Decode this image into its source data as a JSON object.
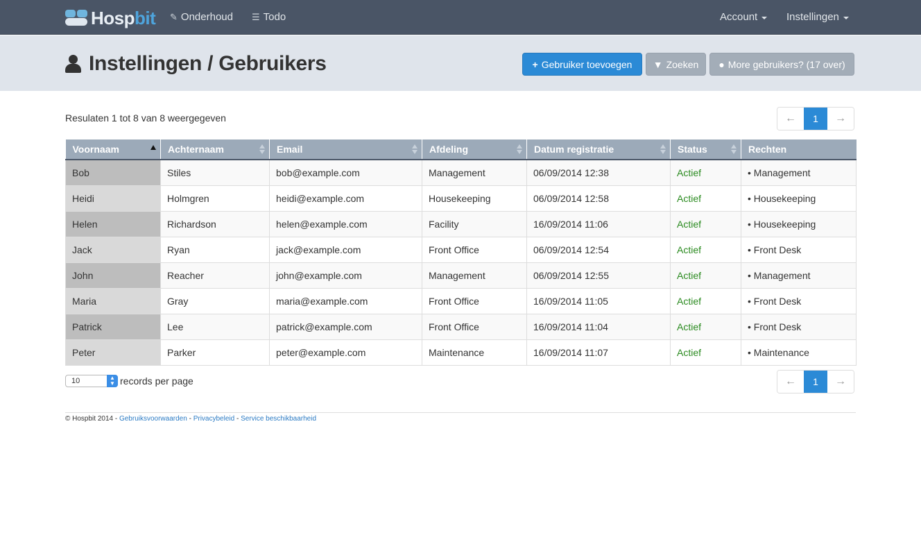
{
  "navbar": {
    "brand_main": "Hosp",
    "brand_accent": "bit",
    "maintenance_label": "Onderhoud",
    "todo_label": "Todo",
    "account_label": "Account",
    "settings_label": "Instellingen"
  },
  "header": {
    "title": "Instellingen / Gebruikers",
    "add_user_label": "Gebruiker toevoegen",
    "search_label": "Zoeken",
    "more_users_label": "More gebruikers? (17 over)"
  },
  "results": {
    "summary": "Resulaten 1 tot 8 van 8 weergegeven"
  },
  "pagination": {
    "prev": "←",
    "current_page": "1",
    "next": "→"
  },
  "table": {
    "columns": [
      "Voornaam",
      "Achternaam",
      "Email",
      "Afdeling",
      "Datum registratie",
      "Status",
      "Rechten"
    ],
    "sorted_column": "Voornaam",
    "rows": [
      [
        "Bob",
        "Stiles",
        "bob@example.com",
        "Management",
        "06/09/2014 12:38",
        "Actief",
        "• Management"
      ],
      [
        "Heidi",
        "Holmgren",
        "heidi@example.com",
        "Housekeeping",
        "06/09/2014 12:58",
        "Actief",
        "• Housekeeping"
      ],
      [
        "Helen",
        "Richardson",
        "helen@example.com",
        "Facility",
        "16/09/2014 11:06",
        "Actief",
        "• Housekeeping"
      ],
      [
        "Jack",
        "Ryan",
        "jack@example.com",
        "Front Office",
        "06/09/2014 12:54",
        "Actief",
        "• Front Desk"
      ],
      [
        "John",
        "Reacher",
        "john@example.com",
        "Management",
        "06/09/2014 12:55",
        "Actief",
        "• Management"
      ],
      [
        "Maria",
        "Gray",
        "maria@example.com",
        "Front Office",
        "16/09/2014 11:05",
        "Actief",
        "• Front Desk"
      ],
      [
        "Patrick",
        "Lee",
        "patrick@example.com",
        "Front Office",
        "16/09/2014 11:04",
        "Actief",
        "• Front Desk"
      ],
      [
        "Peter",
        "Parker",
        "peter@example.com",
        "Maintenance",
        "16/09/2014 11:07",
        "Actief",
        "• Maintenance"
      ]
    ]
  },
  "records_per_page": {
    "value": "10",
    "label": "records per page"
  },
  "footer": {
    "copyright": "© Hospbit 2014 - ",
    "terms": "Gebruiksvoorwaarden",
    "sep1": " - ",
    "privacy": "Privacybeleid",
    "sep2": " - ",
    "availability": "Service beschikbaarheid"
  },
  "colors": {
    "navbar": "#4a5566",
    "header_band": "#dfe4eb",
    "primary": "#2b8ad6",
    "table_header": "#9caab9",
    "status_active": "#2a8a1f"
  }
}
